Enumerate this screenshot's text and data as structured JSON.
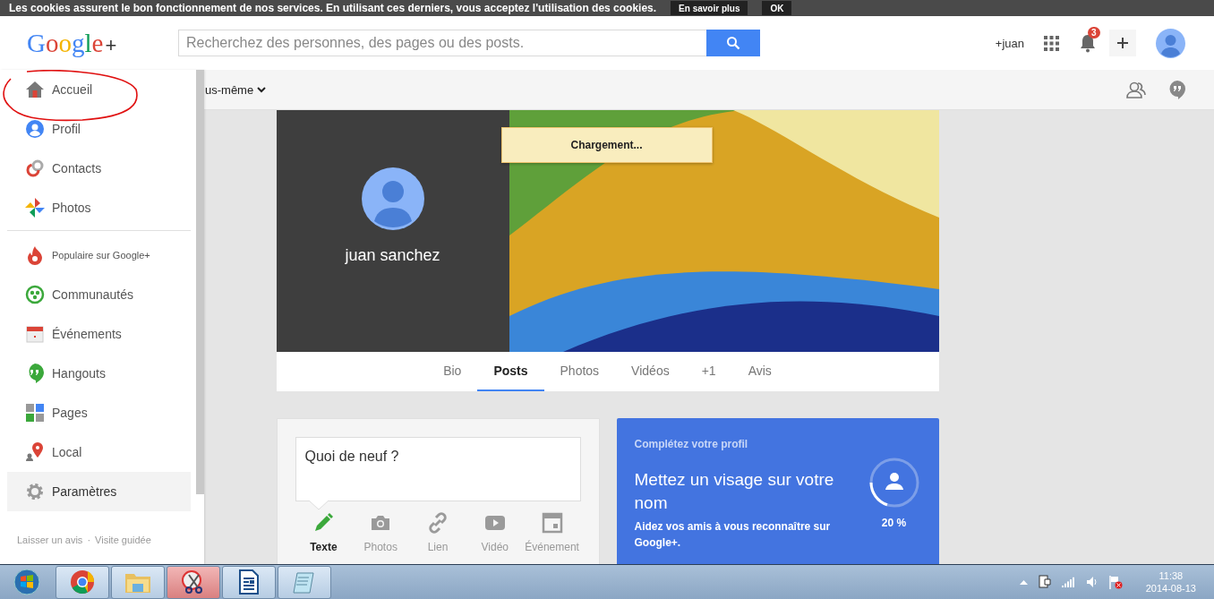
{
  "cookie_bar": {
    "message": "Les cookies assurent le bon fonctionnement de nos services. En utilisant ces derniers, vous acceptez l'utilisation des cookies.",
    "buttons": [
      "En savoir plus",
      "OK"
    ]
  },
  "header": {
    "logo": "Google",
    "logo_plus": "+",
    "search": {
      "placeholder": "Recherchez des personnes, des pages ou des posts."
    },
    "user_link": "+juan",
    "notification_count": "3"
  },
  "subbar": {
    "filter": "us-même"
  },
  "sidebar": {
    "items": [
      {
        "label": "Accueil",
        "selected": false
      },
      {
        "label": "Profil",
        "selected": false
      },
      {
        "label": "Contacts",
        "selected": false
      },
      {
        "label": "Photos",
        "selected": false
      },
      {
        "label": "Populaire sur Google+",
        "selected": false
      },
      {
        "label": "Communautés",
        "selected": false
      },
      {
        "label": "Événements",
        "selected": false
      },
      {
        "label": "Hangouts",
        "selected": false
      },
      {
        "label": "Pages",
        "selected": false
      },
      {
        "label": "Local",
        "selected": false
      },
      {
        "label": "Paramètres",
        "selected": true
      }
    ],
    "footer_links": [
      "Laisser un avis",
      "Visite guidée"
    ],
    "footer_separator": "·"
  },
  "profile": {
    "name": "juan sanchez",
    "loading": "Chargement...",
    "tabs": [
      {
        "label": "Bio",
        "selected": false
      },
      {
        "label": "Posts",
        "selected": true
      },
      {
        "label": "Photos",
        "selected": false
      },
      {
        "label": "Vidéos",
        "selected": false
      },
      {
        "label": "+1",
        "selected": false
      },
      {
        "label": "Avis",
        "selected": false
      }
    ]
  },
  "composer": {
    "placeholder": "Quoi de neuf ?",
    "options": [
      {
        "label": "Texte",
        "selected": true
      },
      {
        "label": "Photos",
        "selected": false
      },
      {
        "label": "Lien",
        "selected": false
      },
      {
        "label": "Vidéo",
        "selected": false
      },
      {
        "label": "Événement",
        "selected": false
      }
    ]
  },
  "complete_profile": {
    "heading": "Complétez votre profil",
    "title": "Mettez un visage sur votre nom",
    "text": "Aidez vos amis à vous reconnaître sur Google+.",
    "level": 0.2,
    "percent": "20 %"
  },
  "taskbar": {
    "apps": [
      {
        "selected": false
      },
      {
        "selected": false
      },
      {
        "selected": true
      },
      {
        "selected": false
      },
      {
        "selected": false
      }
    ],
    "time": "11:38",
    "date": "2014-08-13"
  }
}
